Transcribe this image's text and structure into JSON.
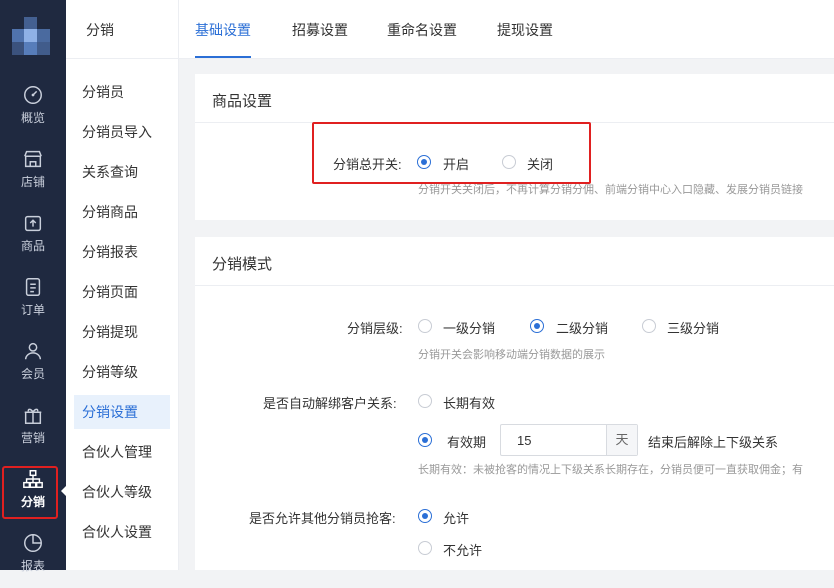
{
  "rail": {
    "items": [
      {
        "label": "概览",
        "icon": "dashboard-icon"
      },
      {
        "label": "店铺",
        "icon": "store-icon"
      },
      {
        "label": "商品",
        "icon": "goods-icon"
      },
      {
        "label": "订单",
        "icon": "order-icon"
      },
      {
        "label": "会员",
        "icon": "member-icon"
      },
      {
        "label": "营销",
        "icon": "gift-icon"
      },
      {
        "label": "分销",
        "icon": "distribution-icon"
      },
      {
        "label": "报表",
        "icon": "report-icon"
      }
    ]
  },
  "submenu": {
    "title": "分销",
    "items": [
      "分销员",
      "分销员导入",
      "关系查询",
      "分销商品",
      "分销报表",
      "分销页面",
      "分销提现",
      "分销等级",
      "分销设置",
      "合伙人管理",
      "合伙人等级",
      "合伙人设置"
    ],
    "active": "分销设置"
  },
  "tabs": [
    "基础设置",
    "招募设置",
    "重命名设置",
    "提现设置"
  ],
  "goods_section": {
    "title": "商品设置",
    "switch_label": "分销总开关:",
    "on_label": "开启",
    "off_label": "关闭",
    "hint": "分销开关关闭后，不再计算分销分佣、前端分销中心入口隐藏、发展分销员链接"
  },
  "mode_section": {
    "title": "分销模式",
    "level_label": "分销层级:",
    "level_options": [
      "一级分销",
      "二级分销",
      "三级分销"
    ],
    "level_hint": "分销开关会影响移动端分销数据的展示",
    "unbind_label": "是否自动解绑客户关系:",
    "unbind_long": "长期有效",
    "unbind_period": "有效期",
    "period_value": "15",
    "period_unit": "天",
    "period_suffix": "结束后解除上下级关系",
    "unbind_hint": "长期有效：未被抢客的情况上下级关系长期存在，分销员便可一直获取佣金；有",
    "grab_label": "是否允许其他分销员抢客:",
    "grab_yes": "允许",
    "grab_no": "不允许"
  },
  "colors": {
    "primary": "#2b6fd6",
    "rail_bg": "#1f2940",
    "highlight": "#e02020"
  }
}
